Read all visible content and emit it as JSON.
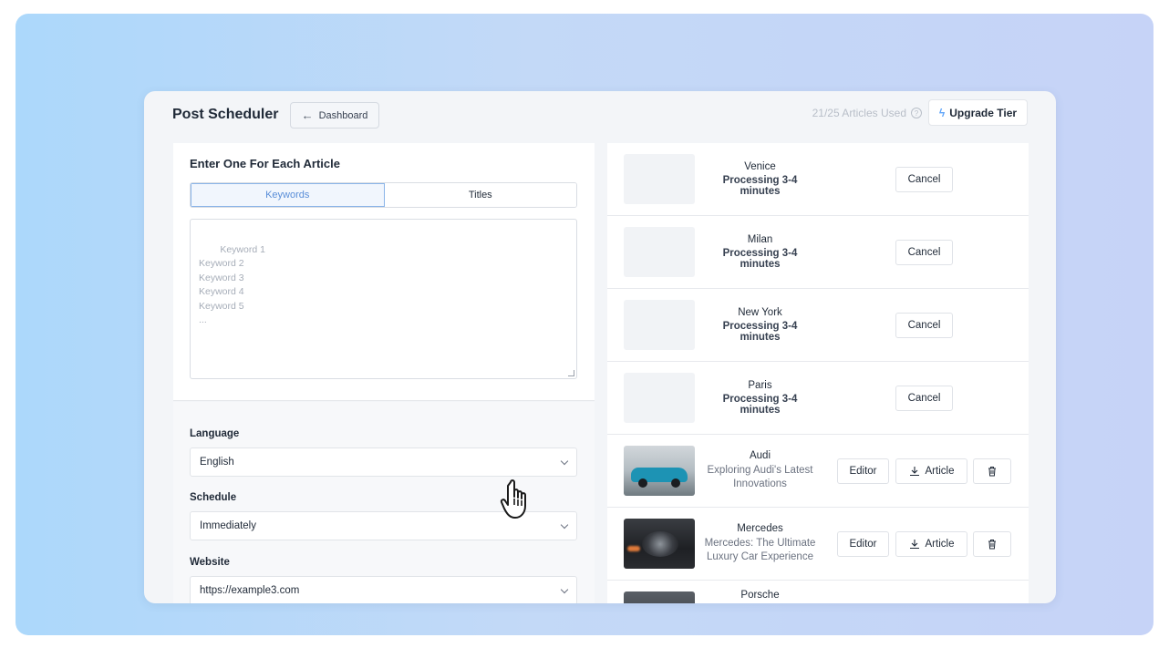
{
  "header": {
    "title": "Post Scheduler",
    "dashboard_label": "Dashboard",
    "usage_text": "21/25 Articles Used",
    "upgrade_label": "Upgrade Tier"
  },
  "input_panel": {
    "title": "Enter One For Each Article",
    "tabs": [
      "Keywords",
      "Titles"
    ],
    "active_tab": "Keywords",
    "placeholder": "Keyword 1\nKeyword 2\nKeyword 3\nKeyword 4\nKeyword 5\n..."
  },
  "settings": {
    "language_label": "Language",
    "language_value": "English",
    "schedule_label": "Schedule",
    "schedule_value": "Immediately",
    "website_label": "Website",
    "website_value": "https://example3.com"
  },
  "articles": [
    {
      "name": "Venice",
      "status": "Processing 3-4 minutes",
      "action": "Cancel"
    },
    {
      "name": "Milan",
      "status": "Processing 3-4 minutes",
      "action": "Cancel"
    },
    {
      "name": "New York",
      "status": "Processing 3-4 minutes",
      "action": "Cancel"
    },
    {
      "name": "Paris",
      "status": "Processing 3-4 minutes",
      "action": "Cancel"
    },
    {
      "name": "Audi",
      "description": "Exploring Audi's Latest Innovations",
      "editor_label": "Editor",
      "article_label": "Article"
    },
    {
      "name": "Mercedes",
      "description": "Mercedes: The Ultimate Luxury Car Experience",
      "editor_label": "Editor",
      "article_label": "Article"
    },
    {
      "name": "Porsche"
    }
  ],
  "colors": {
    "accent": "#5a8ed8",
    "bolt": "#60a5fa"
  }
}
